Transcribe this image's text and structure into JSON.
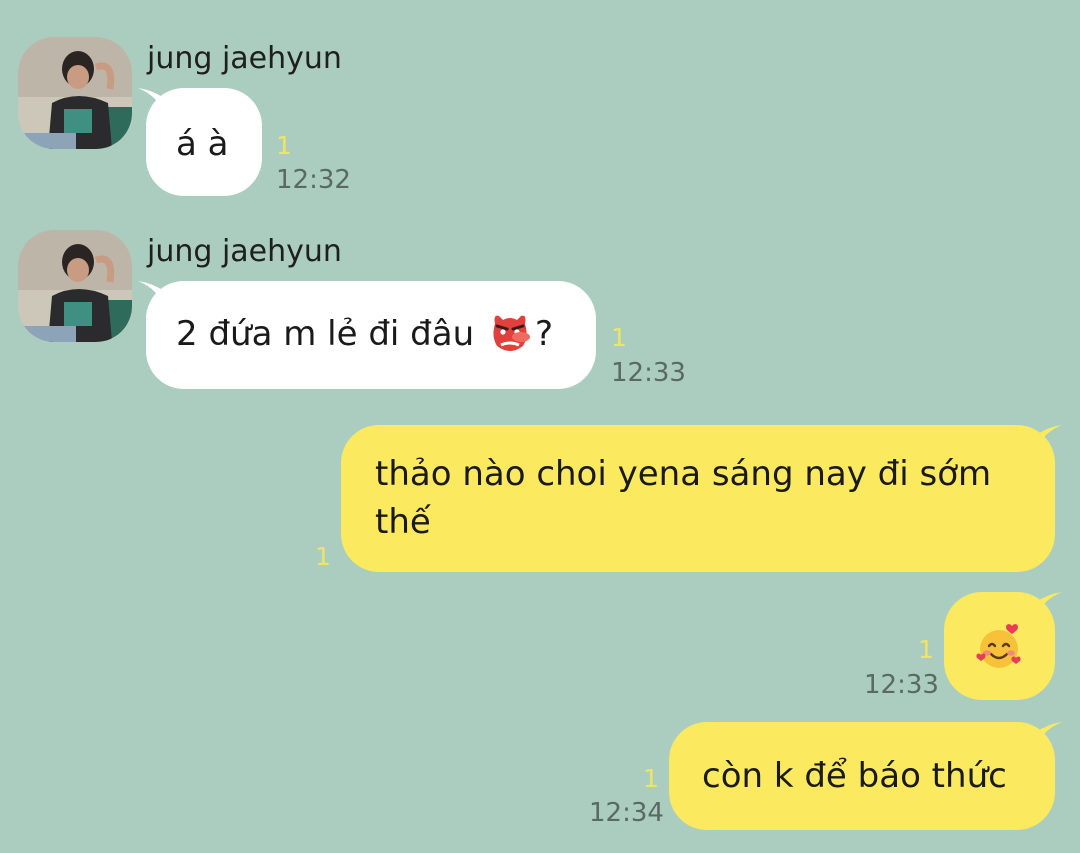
{
  "messages": [
    {
      "direction": "incoming",
      "sender": "jung jaehyun",
      "text": "á à",
      "unread": "1",
      "time": "12:32"
    },
    {
      "direction": "incoming",
      "sender": "jung jaehyun",
      "text": "2 đứa m lẻ đi đâu",
      "emoji_after": "goblin-mask-emoji",
      "text_suffix": "?",
      "unread": "1",
      "time": "12:33"
    },
    {
      "direction": "outgoing",
      "text_line1": "thảo nào choi yena sáng nay đi sớm",
      "text_line2": "thế",
      "unread": "1",
      "time": ""
    },
    {
      "direction": "outgoing",
      "emoji": "smiling-face-with-hearts-emoji",
      "unread": "1",
      "time": "12:33"
    },
    {
      "direction": "outgoing",
      "text": "còn k để báo thức",
      "unread": "1",
      "time": "12:34"
    }
  ],
  "colors": {
    "background": "#abcdc0",
    "incoming_bubble": "#ffffff",
    "outgoing_bubble": "#fbe95f",
    "unread_count": "#f2e463",
    "timestamp": "#5a6963"
  }
}
